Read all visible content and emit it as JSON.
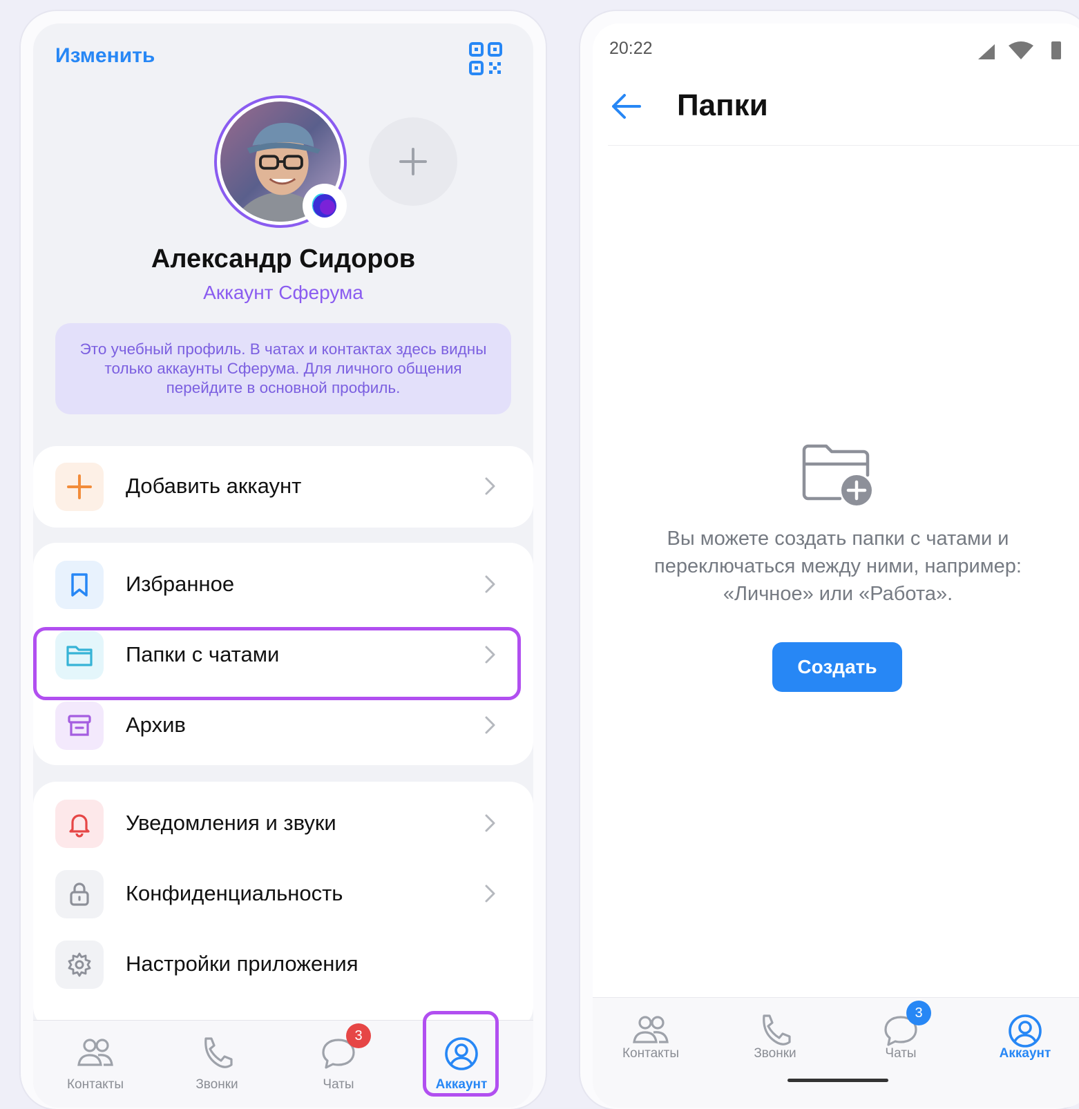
{
  "left": {
    "header": {
      "edit_label": "Изменить",
      "qr_icon": "qr-code-icon"
    },
    "profile": {
      "name": "Александр Сидоров",
      "subtitle": "Аккаунт Сферума",
      "info": "Это учебный профиль. В чатах и контактах здесь видны только аккаунты Сферума. Для личного общения перейдите в основной профиль."
    },
    "menu": {
      "add_account": "Добавить аккаунт",
      "favorites": "Избранное",
      "folders": "Папки с чатами",
      "archive": "Архив",
      "notifications": "Уведомления и звуки",
      "privacy": "Конфиденциальность",
      "settings": "Настройки приложения"
    },
    "tabs": [
      {
        "label": "Контакты",
        "icon": "contacts-icon"
      },
      {
        "label": "Звонки",
        "icon": "phone-icon"
      },
      {
        "label": "Чаты",
        "icon": "chat-icon",
        "badge": "3"
      },
      {
        "label": "Аккаунт",
        "icon": "account-icon",
        "active": true
      }
    ]
  },
  "right": {
    "status": {
      "time": "20:22"
    },
    "title": "Папки",
    "empty_text": "Вы можете создать папки с чатами и переключаться между ними, например: «Личное» или «Работа».",
    "create_label": "Создать",
    "tabs": [
      {
        "label": "Контакты",
        "icon": "contacts-icon"
      },
      {
        "label": "Звонки",
        "icon": "phone-icon"
      },
      {
        "label": "Чаты",
        "icon": "chat-icon",
        "badge": "3"
      },
      {
        "label": "Аккаунт",
        "icon": "account-icon",
        "active": true
      }
    ]
  },
  "colors": {
    "accent": "#2787f5",
    "highlight": "#b14ff0",
    "sferum": "#8a5cf0",
    "badge_red": "#e64646"
  }
}
